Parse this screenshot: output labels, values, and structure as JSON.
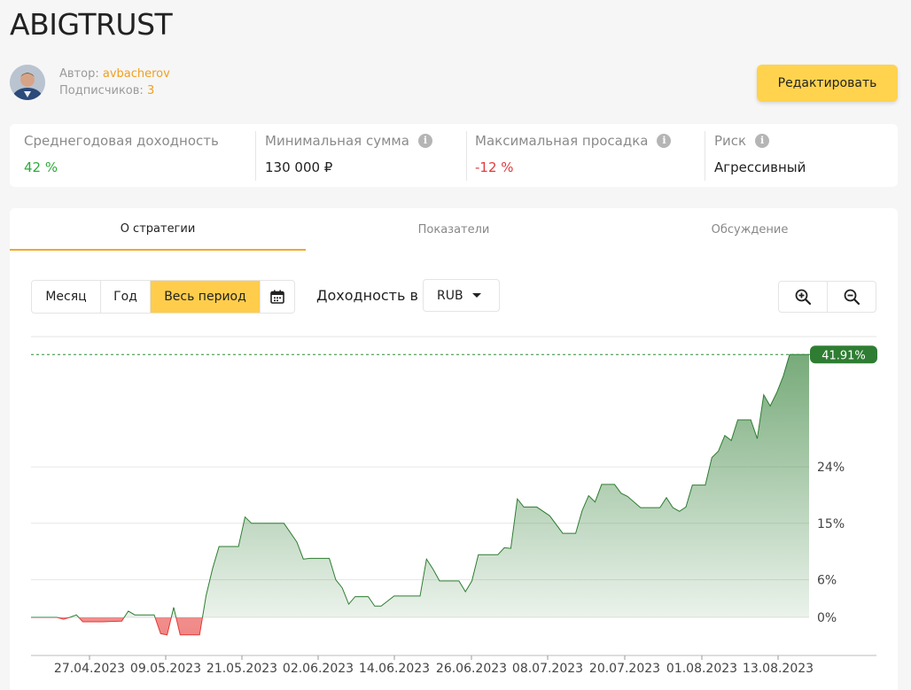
{
  "page": {
    "title": "ABIGTRUST"
  },
  "author": {
    "label": "Автор:",
    "name": "avbacherov",
    "subscribers_label": "Подписчиков:",
    "subscribers_count": "3"
  },
  "actions": {
    "edit_label": "Редактировать"
  },
  "stats": [
    {
      "label": "Среднегодовая доходность",
      "value": "42 %",
      "status": "positive",
      "info": false
    },
    {
      "label": "Минимальная сумма",
      "value": "130 000 ₽",
      "status": "neutral",
      "info": true
    },
    {
      "label": "Максимальная просадка",
      "value": "-12 %",
      "status": "negative",
      "info": true
    },
    {
      "label": "Риск",
      "value": "Агрессивный",
      "status": "neutral",
      "info": true
    }
  ],
  "tabs": [
    {
      "label": "О стратегии",
      "active": true
    },
    {
      "label": "Показатели",
      "active": false
    },
    {
      "label": "Обсуждение",
      "active": false
    }
  ],
  "period": {
    "options": [
      {
        "label": "Месяц",
        "active": false
      },
      {
        "label": "Год",
        "active": false
      },
      {
        "label": "Весь период",
        "active": true
      }
    ],
    "calendar_icon": "calendar-icon"
  },
  "yield": {
    "label": "Доходность в",
    "currency": "RUB"
  },
  "zoom": {
    "in_icon": "zoom-in-icon",
    "out_icon": "zoom-out-icon"
  },
  "colors": {
    "accent": "#ffcd4b",
    "positive": "#2e8b3a",
    "negative": "#e33b3b",
    "tab_underline": "#f2a82a"
  },
  "chart_data": {
    "type": "area",
    "x_ticks": [
      "27.04.2023",
      "09.05.2023",
      "21.05.2023",
      "02.06.2023",
      "14.06.2023",
      "26.06.2023",
      "08.07.2023",
      "20.07.2023",
      "01.08.2023",
      "13.08.2023"
    ],
    "y_ticks": [
      "0%",
      "6%",
      "15%",
      "24%"
    ],
    "y_tick_values": [
      0,
      6,
      15,
      24
    ],
    "ylim": [
      -3,
      45
    ],
    "last_value_label": "41.91%",
    "last_value": 41.91,
    "x_start": "2023-04-15",
    "x_end": "2023-08-13",
    "series": [
      {
        "values": [
          [
            "2023-04-15",
            0
          ],
          [
            "2023-04-19",
            0
          ],
          [
            "2023-04-20",
            -0.3
          ],
          [
            "2023-04-21",
            0
          ],
          [
            "2023-04-22",
            0.4
          ],
          [
            "2023-04-23",
            -0.7
          ],
          [
            "2023-04-26",
            -0.7
          ],
          [
            "2023-04-29",
            -0.6
          ],
          [
            "2023-04-30",
            1
          ],
          [
            "2023-05-01",
            0.4
          ],
          [
            "2023-05-04",
            0.4
          ],
          [
            "2023-05-05",
            -2.6
          ],
          [
            "2023-05-06",
            -2.8
          ],
          [
            "2023-05-07",
            1.6
          ],
          [
            "2023-05-08",
            -2.8
          ],
          [
            "2023-05-11",
            -2.8
          ],
          [
            "2023-05-12",
            3.5
          ],
          [
            "2023-05-13",
            7.8
          ],
          [
            "2023-05-14",
            11.3
          ],
          [
            "2023-05-17",
            11.3
          ],
          [
            "2023-05-18",
            16
          ],
          [
            "2023-05-19",
            15
          ],
          [
            "2023-05-24",
            15
          ],
          [
            "2023-05-26",
            12
          ],
          [
            "2023-05-27",
            9.3
          ],
          [
            "2023-05-28",
            9.4
          ],
          [
            "2023-05-31",
            9.4
          ],
          [
            "2023-06-01",
            6
          ],
          [
            "2023-06-02",
            4.7
          ],
          [
            "2023-06-03",
            2.1
          ],
          [
            "2023-06-04",
            3.3
          ],
          [
            "2023-06-06",
            3.3
          ],
          [
            "2023-06-07",
            1.8
          ],
          [
            "2023-06-08",
            1.8
          ],
          [
            "2023-06-10",
            3.4
          ],
          [
            "2023-06-14",
            3.4
          ],
          [
            "2023-06-15",
            9.3
          ],
          [
            "2023-06-16",
            7.7
          ],
          [
            "2023-06-17",
            5.8
          ],
          [
            "2023-06-20",
            5.8
          ],
          [
            "2023-06-21",
            4.1
          ],
          [
            "2023-06-22",
            5.8
          ],
          [
            "2023-06-23",
            10
          ],
          [
            "2023-06-26",
            10
          ],
          [
            "2023-06-27",
            11.1
          ],
          [
            "2023-06-28",
            11
          ],
          [
            "2023-06-29",
            18.9
          ],
          [
            "2023-06-30",
            17.6
          ],
          [
            "2023-07-02",
            17.6
          ],
          [
            "2023-07-04",
            16.2
          ],
          [
            "2023-07-06",
            13.4
          ],
          [
            "2023-07-08",
            13.4
          ],
          [
            "2023-07-09",
            17
          ],
          [
            "2023-07-10",
            19.4
          ],
          [
            "2023-07-11",
            18.4
          ],
          [
            "2023-07-12",
            21.2
          ],
          [
            "2023-07-14",
            21.2
          ],
          [
            "2023-07-15",
            19.8
          ],
          [
            "2023-07-16",
            19.3
          ],
          [
            "2023-07-18",
            17.5
          ],
          [
            "2023-07-21",
            17.5
          ],
          [
            "2023-07-22",
            19.1
          ],
          [
            "2023-07-23",
            17.5
          ],
          [
            "2023-07-24",
            16.9
          ],
          [
            "2023-07-25",
            17.6
          ],
          [
            "2023-07-26",
            21.1
          ],
          [
            "2023-07-28",
            21.1
          ],
          [
            "2023-07-29",
            25.5
          ],
          [
            "2023-07-30",
            26.5
          ],
          [
            "2023-07-31",
            29
          ],
          [
            "2023-08-01",
            28.2
          ],
          [
            "2023-08-02",
            31.5
          ],
          [
            "2023-08-04",
            31.5
          ],
          [
            "2023-08-05",
            28.5
          ],
          [
            "2023-08-06",
            35.5
          ],
          [
            "2023-08-07",
            33.7
          ],
          [
            "2023-08-08",
            35.8
          ],
          [
            "2023-08-09",
            38.4
          ],
          [
            "2023-08-10",
            41.9
          ],
          [
            "2023-08-11",
            41.91
          ],
          [
            "2023-08-13",
            41.91
          ]
        ]
      }
    ]
  }
}
